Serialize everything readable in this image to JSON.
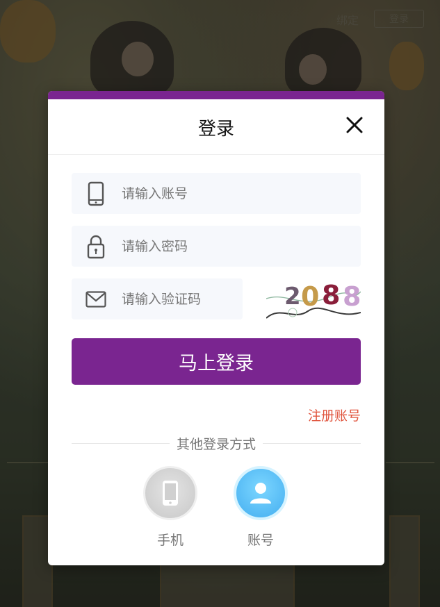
{
  "background": {
    "top_links": [
      "绑定",
      "登录"
    ]
  },
  "modal": {
    "title": "登录",
    "accent_color": "#7a2590",
    "close_icon": "close-icon",
    "fields": {
      "account": {
        "placeholder": "请输入账号",
        "icon": "mobile-phone-icon"
      },
      "password": {
        "placeholder": "请输入密码",
        "icon": "lock-icon"
      },
      "captcha": {
        "placeholder": "请输入验证码",
        "icon": "envelope-icon",
        "captcha_text": "2088"
      }
    },
    "submit_label": "马上登录",
    "register_label": "注册账号",
    "register_color": "#e0553e",
    "other_methods_label": "其他登录方式",
    "methods": [
      {
        "label": "手机",
        "icon": "mobile-phone-icon"
      },
      {
        "label": "账号",
        "icon": "user-icon"
      }
    ]
  }
}
